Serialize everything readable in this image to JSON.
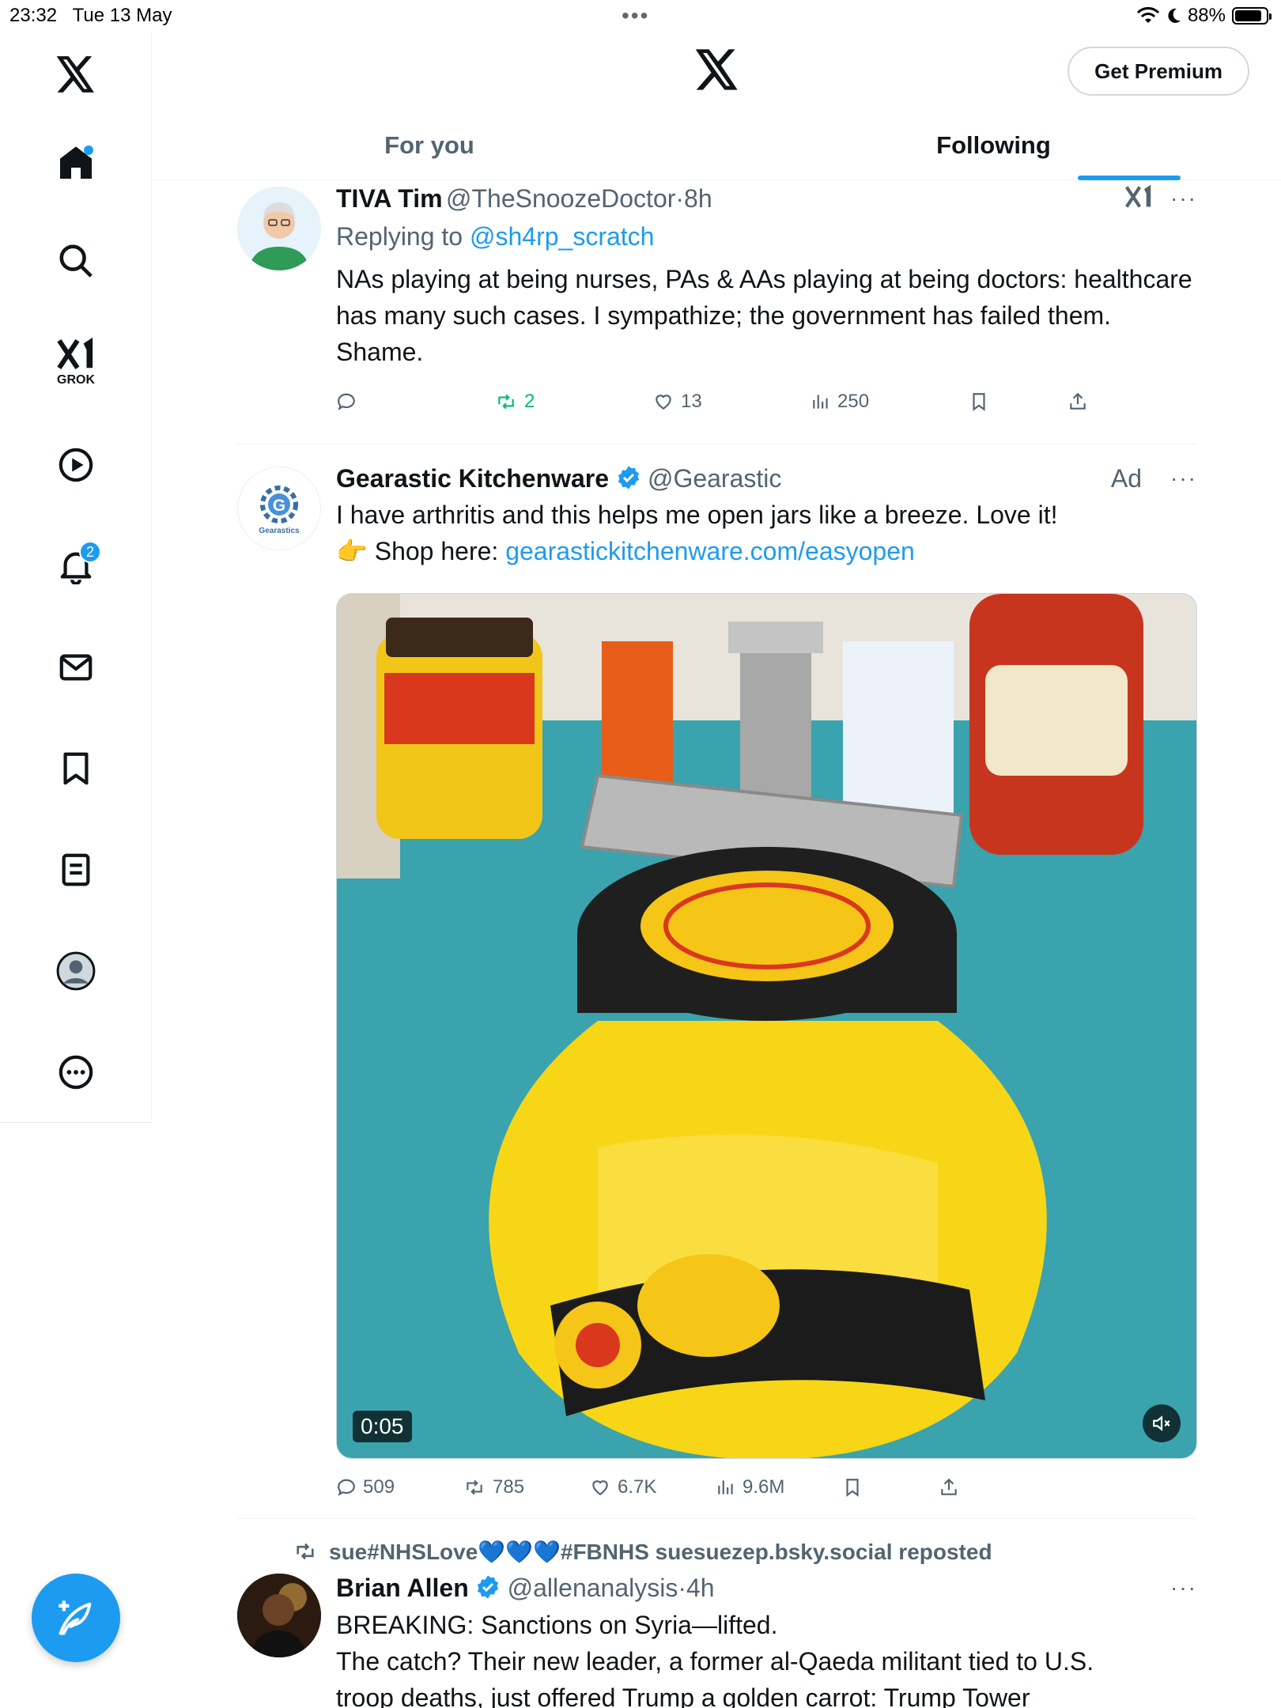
{
  "status": {
    "time": "23:32",
    "date": "Tue 13 May",
    "battery": "88%",
    "battery_level": 0.88
  },
  "header": {
    "premium_label": "Get Premium",
    "tabs": [
      {
        "label": "For you"
      },
      {
        "label": "Following"
      }
    ]
  },
  "sidebar": {
    "grok_label": "GROK",
    "notifications_badge": "2"
  },
  "tweets": [
    {
      "name": "TIVA Tim",
      "handle": "@TheSnoozeDoctor",
      "time": "8h",
      "reply_prefix": "Replying to ",
      "reply_to": "@sh4rp_scratch",
      "text": "NAs playing at being nurses, PAs & AAs playing at being doctors: healthcare has many such cases. I sympathize; the government has failed them. Shame.",
      "reposts": "2",
      "likes": "13",
      "views": "250"
    },
    {
      "name": "Gearastic Kitchenware",
      "handle": "@Gearastic",
      "ad_label": "Ad",
      "avatar_text": "Gearastics",
      "text": "I have arthritis and this helps me open jars like a breeze. Love it!",
      "shop_emoji": "👉",
      "shop_label": " Shop here: ",
      "shop_link": "gearastickitchenware.com/easyopen",
      "video_time": "0:05",
      "replies": "509",
      "reposts": "785",
      "likes": "6.7K",
      "views": "9.6M"
    },
    {
      "repost_by": "sue#NHSLove💙💙💙#FBNHS suesuezep.bsky.social reposted",
      "name": "Brian Allen",
      "handle": "@allenanalysis",
      "time": "4h",
      "text_line1": "BREAKING: Sanctions on Syria—lifted.",
      "text_line2": "The catch? Their new leader, a former al-Qaeda militant tied to U.S.",
      "text_line3": "troop deaths, just offered Trump a golden carrot: Trump Tower"
    }
  ]
}
